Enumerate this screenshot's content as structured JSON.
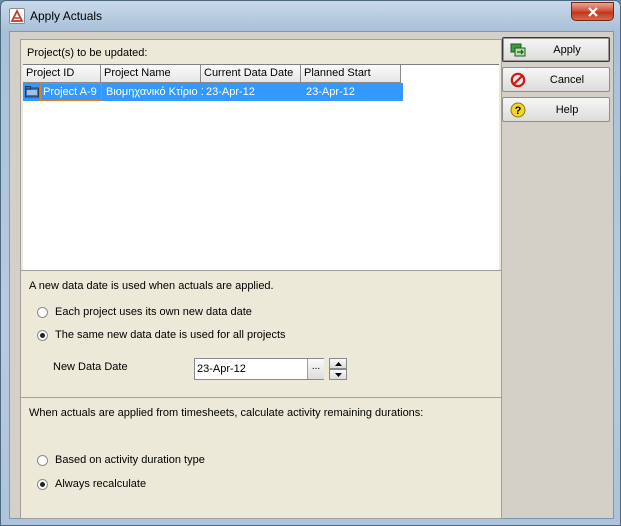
{
  "window": {
    "title": "Apply Actuals"
  },
  "grid": {
    "section_title": "Project(s) to be updated:",
    "columns": [
      "Project ID",
      "Project Name",
      "Current Data Date",
      "Planned Start"
    ],
    "rows": [
      {
        "id": "Project A-9",
        "name": "Βιομηχανικό Κτίριο 1",
        "current_data_date": "23-Apr-12",
        "planned_start": "23-Apr-12"
      }
    ]
  },
  "data_date_section": {
    "info": "A new data date is used when actuals are applied.",
    "option_each": "Each project uses its own new data date",
    "option_same": "The same new data date is used for all projects",
    "selected": "same",
    "new_date_label": "New Data Date",
    "new_date_value": "23-Apr-12",
    "browse_label": "..."
  },
  "duration_section": {
    "info": "When actuals are applied from timesheets, calculate activity remaining durations:",
    "option_type": "Based on activity duration type",
    "option_recalc": "Always recalculate",
    "selected": "recalc"
  },
  "buttons": {
    "apply": "Apply",
    "cancel": "Cancel",
    "help": "Help"
  },
  "icons": {
    "app": "primavera-app-icon",
    "close": "close-icon",
    "apply": "apply-icon",
    "cancel": "cancel-icon",
    "help": "help-icon",
    "folder": "project-folder-icon"
  }
}
